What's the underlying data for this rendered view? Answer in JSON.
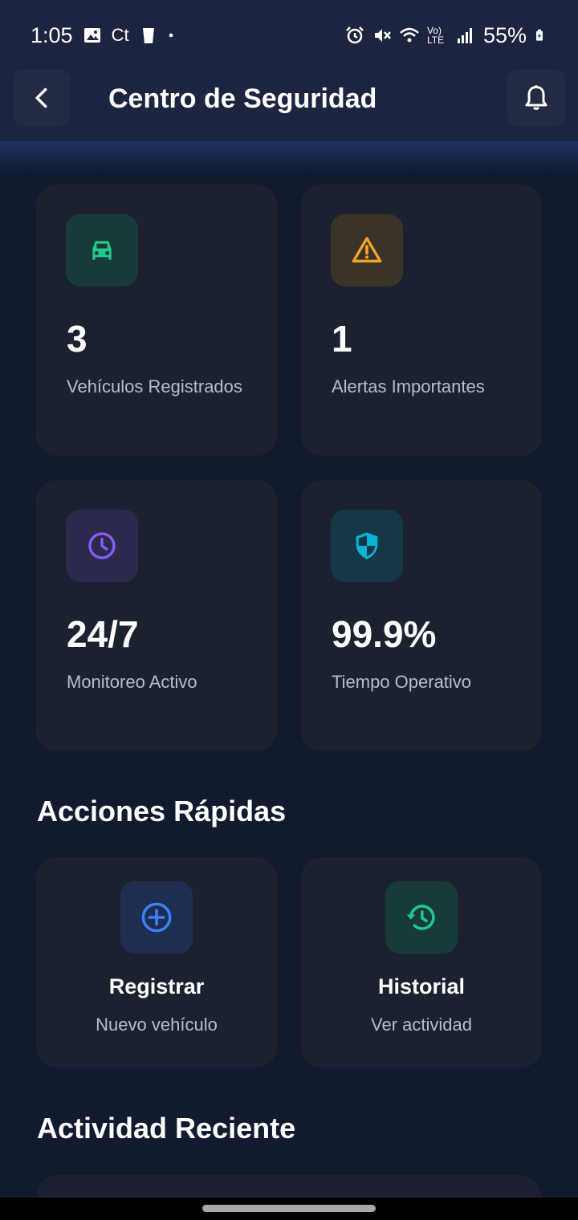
{
  "status_bar": {
    "time": "1:05",
    "carrier_label": "Ct",
    "network_label": "Vo) LTE",
    "battery": "55%"
  },
  "header": {
    "title": "Centro de Seguridad",
    "back_icon": "chevron-left-icon",
    "bell_icon": "bell-icon"
  },
  "stats": [
    {
      "value": "3",
      "label": "Vehículos Registrados",
      "icon": "car-icon",
      "color": "#22c98e",
      "bg": "#183b3a"
    },
    {
      "value": "1",
      "label": "Alertas Importantes",
      "icon": "warning-icon",
      "color": "#f5a524",
      "bg": "#3a3428"
    },
    {
      "value": "24/7",
      "label": "Monitoreo Activo",
      "icon": "clock-icon",
      "color": "#8b5cf6",
      "bg": "#2b2a4d"
    },
    {
      "value": "99.9%",
      "label": "Tiempo Operativo",
      "icon": "shield-icon",
      "color": "#06b6d4",
      "bg": "#163746"
    }
  ],
  "quick_actions": {
    "title": "Acciones Rápidas",
    "items": [
      {
        "title": "Registrar",
        "subtitle": "Nuevo vehículo",
        "icon": "add-circle-icon",
        "color": "#3b82f6",
        "bg": "#1e2e52"
      },
      {
        "title": "Historial",
        "subtitle": "Ver actividad",
        "icon": "history-icon",
        "color": "#22c98e",
        "bg": "#183b3a"
      }
    ]
  },
  "recent_activity": {
    "title": "Actividad Reciente"
  }
}
